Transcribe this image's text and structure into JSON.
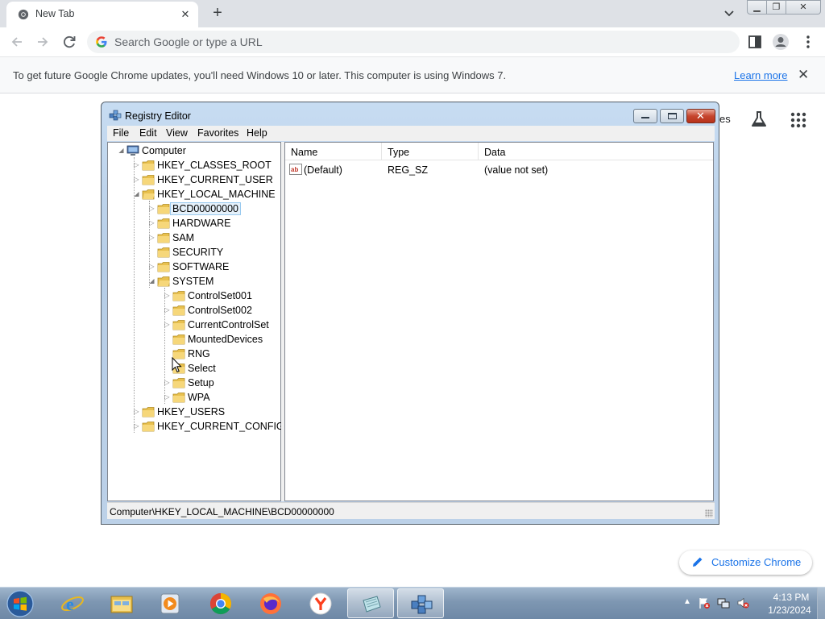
{
  "browser": {
    "tab_title": "New Tab",
    "omnibox_placeholder": "Search Google or type a URL",
    "infobar_message": "To get future Google Chrome updates, you'll need Windows 10 or later. This computer is using Windows 7.",
    "infobar_link": "Learn more",
    "ntp_partial_text": "es",
    "customize_label": "Customize Chrome"
  },
  "regedit": {
    "title": "Registry Editor",
    "menu": [
      "File",
      "Edit",
      "View",
      "Favorites",
      "Help"
    ],
    "tree": {
      "root": "Computer",
      "hives": [
        "HKEY_CLASSES_ROOT",
        "HKEY_CURRENT_USER",
        "HKEY_LOCAL_MACHINE",
        "HKEY_USERS",
        "HKEY_CURRENT_CONFIG"
      ],
      "hklm_children": [
        "BCD00000000",
        "HARDWARE",
        "SAM",
        "SECURITY",
        "SOFTWARE",
        "SYSTEM"
      ],
      "system_children": [
        "ControlSet001",
        "ControlSet002",
        "CurrentControlSet",
        "MountedDevices",
        "RNG",
        "Select",
        "Setup",
        "WPA"
      ],
      "selected": "BCD00000000"
    },
    "columns": [
      "Name",
      "Type",
      "Data"
    ],
    "values": [
      {
        "name": "(Default)",
        "type": "REG_SZ",
        "data": "(value not set)"
      }
    ],
    "status_path": "Computer\\HKEY_LOCAL_MACHINE\\BCD00000000"
  },
  "taskbar": {
    "time": "4:13 PM",
    "date": "1/23/2024"
  },
  "colors": {
    "chrome_frame": "#dee1e6",
    "link_blue": "#1a73e8",
    "taskbar": "#7e97b2",
    "selection": "#e5f1fb"
  }
}
